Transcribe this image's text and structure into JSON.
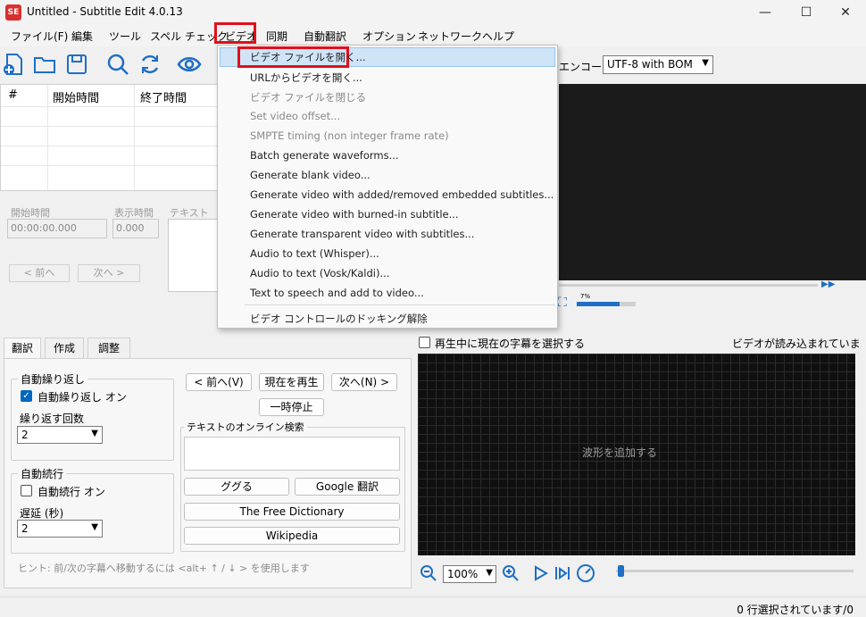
{
  "window": {
    "title": "Untitled - Subtitle Edit 4.0.13",
    "icon_text": "SE"
  },
  "menubar": [
    "ファイル(F)",
    "編集",
    "ツール",
    "スペル チェック",
    "ビデオ",
    "同期",
    "自動翻訳",
    "オプション",
    "ネットワーク",
    "ヘルプ"
  ],
  "toolbar": {
    "encoding_label": "エンコード",
    "encoding_value": "UTF-8 with BOM"
  },
  "grid": {
    "col_num": "#",
    "col_start": "開始時間",
    "col_end": "終了時間"
  },
  "edit": {
    "start_label": "開始時間",
    "duration_label": "表示時間",
    "text_label": "テキスト",
    "start_value": "00:00:00.000",
    "duration_value": "0.000",
    "prev_button": "< 前へ",
    "next_button": "次へ >"
  },
  "video_menu": {
    "items": [
      {
        "label": "ビデオ ファイルを開く...",
        "enabled": true,
        "highlighted": true
      },
      {
        "label": "URLからビデオを開く...",
        "enabled": true
      },
      {
        "label": "ビデオ ファイルを閉じる",
        "enabled": false
      },
      {
        "label": "Set video offset...",
        "enabled": false
      },
      {
        "label": "SMPTE timing (non integer frame rate)",
        "enabled": false
      },
      {
        "label": "Batch generate waveforms...",
        "enabled": true
      },
      {
        "label": "Generate blank video...",
        "enabled": true
      },
      {
        "label": "Generate video with added/removed embedded subtitles...",
        "enabled": true
      },
      {
        "label": "Generate video with burned-in subtitle...",
        "enabled": true
      },
      {
        "label": "Generate transparent video with subtitles...",
        "enabled": true
      },
      {
        "label": "Audio to text (Whisper)...",
        "enabled": true
      },
      {
        "label": "Audio to text (Vosk/Kaldi)...",
        "enabled": true
      },
      {
        "label": "Text to speech and add to video...",
        "enabled": true
      },
      {
        "label": "ビデオ コントロールのドッキング解除",
        "enabled": true
      }
    ]
  },
  "tabs": [
    "翻訳",
    "作成",
    "調整"
  ],
  "translate": {
    "auto_repeat_group": "自動繰り返し",
    "auto_repeat_on": "自動繰り返し オン",
    "repeat_count_label": "繰り返す回数",
    "repeat_count_value": "2",
    "auto_continue_group": "自動続行",
    "auto_continue_on": "自動続行 オン",
    "delay_label": "遅延 (秒)",
    "delay_value": "2",
    "prev_button": "< 前へ(V)",
    "play_current": "現在を再生",
    "next_button": "次へ(N) >",
    "pause_button": "一時停止",
    "search_group": "テキストのオンライン検索",
    "google_search": "ググる",
    "google_translate": "Google 翻訳",
    "free_dictionary": "The Free Dictionary",
    "wikipedia": "Wikipedia",
    "hint": "ヒント: 前/次の字幕へ移動するには <alt+ ↑ / ↓ > を使用します"
  },
  "waveform": {
    "select_current": "再生中に現在の字幕を選択する",
    "no_video": "ビデオが読み込まれていません",
    "add_waveform": "波形を追加する",
    "zoom": "100%"
  },
  "video_controls": {
    "volume_label": "7%"
  },
  "statusbar": {
    "text": "0 行選択されています/0"
  }
}
